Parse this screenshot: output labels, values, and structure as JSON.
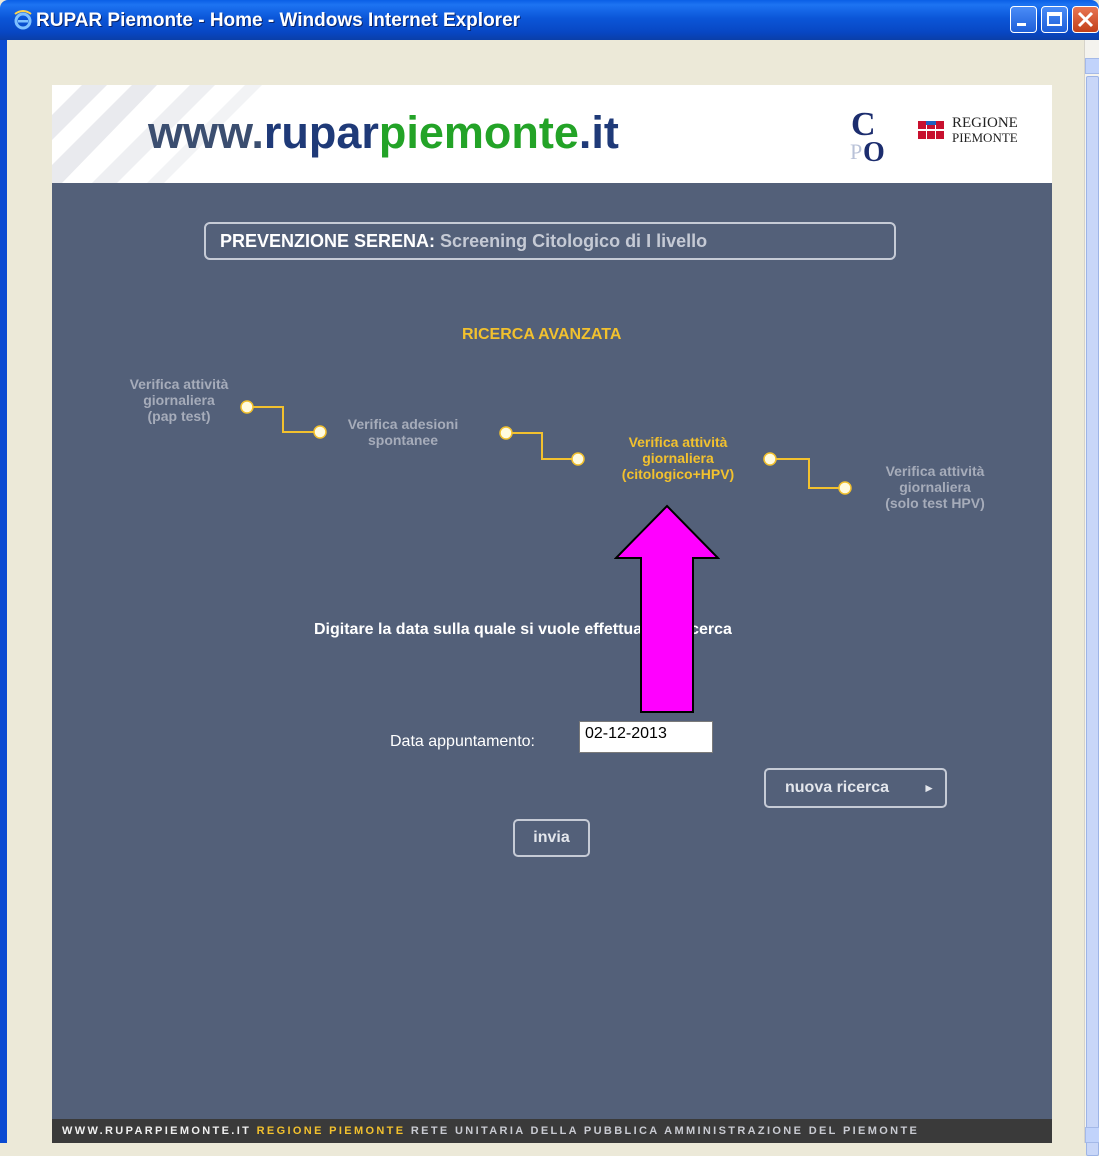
{
  "window": {
    "title": "RUPAR Piemonte - Home - Windows Internet Explorer"
  },
  "header": {
    "logo_www": "www.",
    "logo_rupar": "rupar",
    "logo_piemonte": "piemonte",
    "logo_it": ".it",
    "regione_line1": "REGIONE",
    "regione_line2": "PIEMONTE"
  },
  "section": {
    "strong": "PREVENZIONE SERENA:",
    "rest": " Screening Citologico di I livello"
  },
  "search": {
    "title": "RICERCA AVANZATA",
    "steps": [
      {
        "line1": "Verifica attività",
        "line2": "giornaliera",
        "line3": "(pap test)",
        "active": false
      },
      {
        "line1": "Verifica adesioni",
        "line2": "spontanee",
        "line3": "",
        "active": false
      },
      {
        "line1": "Verifica attività",
        "line2": "giornaliera",
        "line3": "(citologico+HPV)",
        "active": true
      },
      {
        "line1": "Verifica attività",
        "line2": "giornaliera",
        "line3": "(solo test HPV)",
        "active": false
      }
    ],
    "instruction": "Digitare la data sulla quale si vuole effettuare la ricerca",
    "date_label": "Data appuntamento:",
    "date_value": "02-12-2013",
    "submit_label": "invia",
    "new_search_label": "nuova ricerca",
    "new_search_arrow": "►"
  },
  "footer": {
    "site": "WWW.RUPARPIEMONTE.IT",
    "region": "REGIONE PIEMONTE",
    "network": "RETE UNITARIA DELLA PUBBLICA AMMINISTRAZIONE DEL PIEMONTE"
  },
  "colors": {
    "page_bg": "#536079",
    "accent": "#f2c12e",
    "annotation_arrow": "#ff00ff"
  }
}
